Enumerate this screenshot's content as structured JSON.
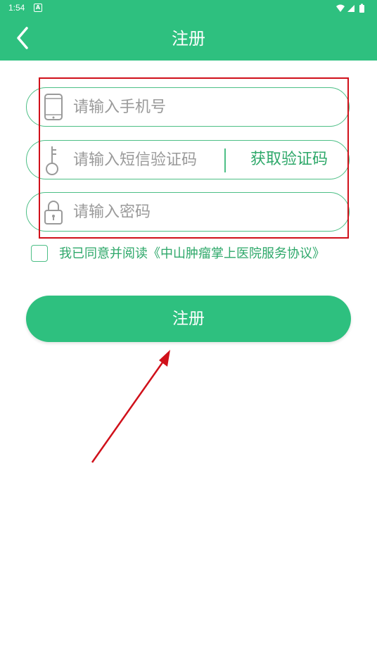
{
  "status_bar": {
    "time": "1:54",
    "notification_icon": "android-notification-icon",
    "icons": [
      "wifi-icon",
      "cell-signal-icon",
      "battery-icon"
    ]
  },
  "header": {
    "title": "注册",
    "back_icon": "back-chevron-icon"
  },
  "form": {
    "phone": {
      "placeholder": "请输入手机号",
      "value": "",
      "icon": "phone-icon"
    },
    "sms_code": {
      "placeholder": "请输入短信验证码",
      "value": "",
      "icon": "key-icon",
      "get_code_label": "获取验证码"
    },
    "password": {
      "placeholder": "请输入密码",
      "value": "",
      "icon": "lock-icon"
    }
  },
  "agreement": {
    "checked": false,
    "text": "我已同意并阅读《中山肿瘤掌上医院服务协议》"
  },
  "actions": {
    "register_label": "注册"
  },
  "colors": {
    "brand_green": "#2ec07f",
    "border_green": "#4dbf86",
    "link_green": "#2ea86a",
    "annotation_red": "#d0101a"
  }
}
